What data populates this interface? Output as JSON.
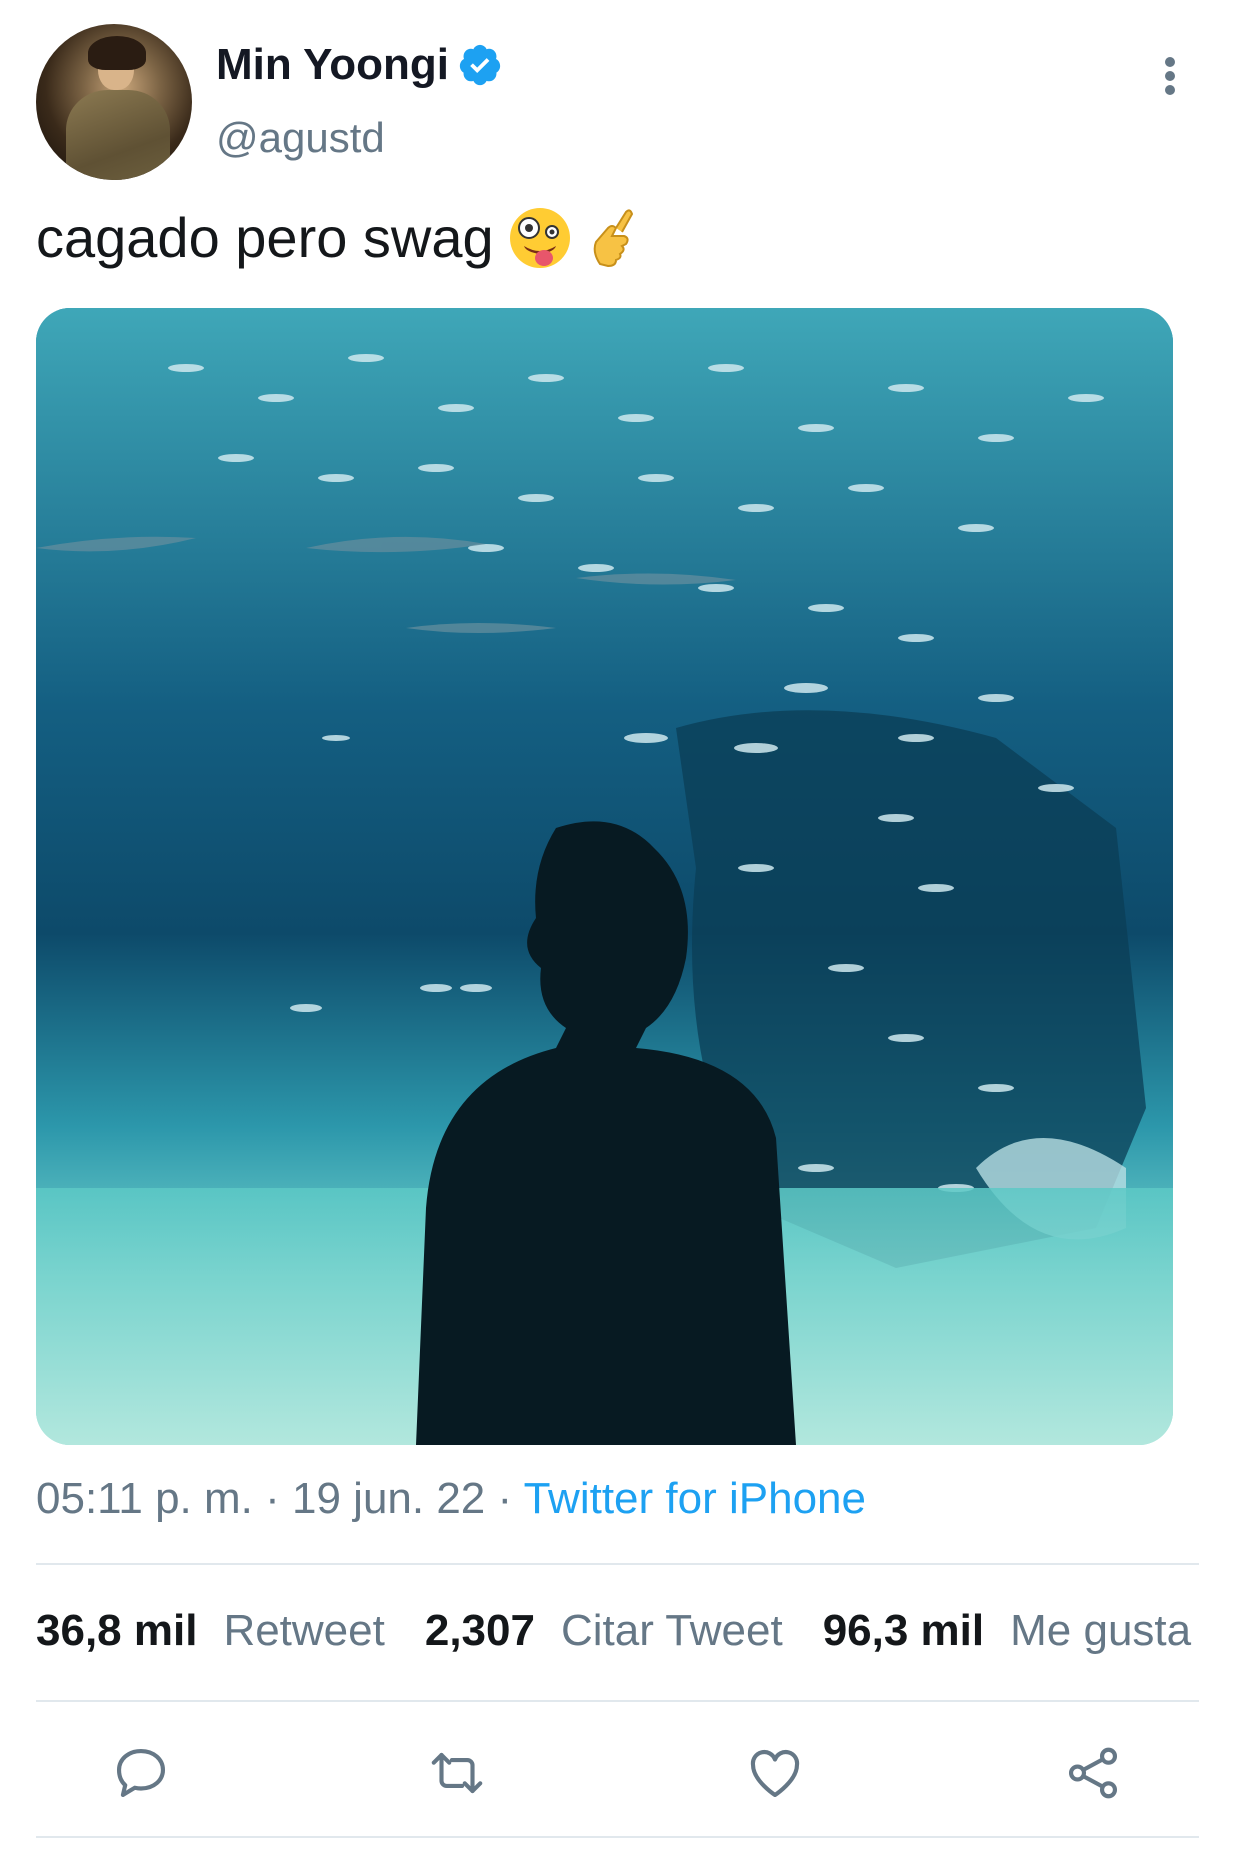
{
  "author": {
    "name": "Min Yoongi",
    "handle": "@agustd",
    "verified_color": "#1da1f2",
    "avatar_icon": "avatar"
  },
  "tweet": {
    "text": "cagado pero swag",
    "emojis": [
      "zany-face-emoji",
      "hand-pointing-emoji"
    ]
  },
  "media": {
    "description_icon": "aquarium-photo"
  },
  "meta": {
    "time": "05:11 p. m.",
    "separator": "·",
    "date": "19 jun. 22",
    "source": "Twitter for iPhone"
  },
  "stats": {
    "retweets_count": "36,8 mil",
    "retweets_label": "Retweet",
    "quotes_count": "2,307",
    "quotes_label": "Citar Tweet",
    "likes_count": "96,3 mil",
    "likes_label": "Me gusta"
  },
  "actions": [
    "reply-icon",
    "retweet-icon",
    "like-icon",
    "share-icon"
  ],
  "colors": {
    "accent": "#1da1f2",
    "secondary_text": "#657786",
    "divider": "#e1e8ed"
  }
}
